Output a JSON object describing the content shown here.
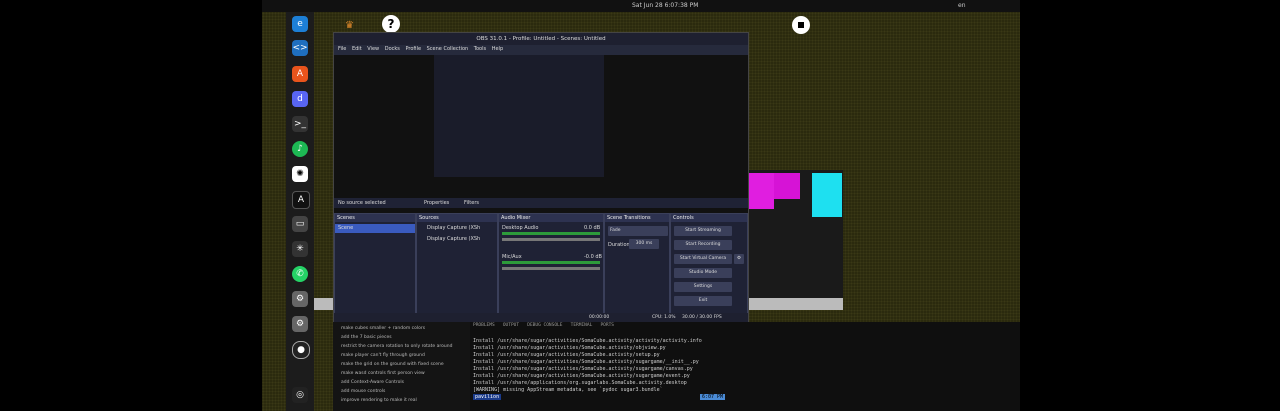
{
  "topbar": {
    "datetime": "Sat Jun 28  6:07:38 PM",
    "lang": "en"
  },
  "obs": {
    "title": "OBS 31.0.1 - Profile: Untitled - Scenes: Untitled",
    "menu": [
      "File",
      "Edit",
      "View",
      "Docks",
      "Profile",
      "Scene Collection",
      "Tools",
      "Help"
    ],
    "no_source": "No source selected",
    "properties": "Properties",
    "filters": "Filters",
    "docks": {
      "scenes": "Scenes",
      "sources": "Sources",
      "audio": "Audio Mixer",
      "transitions": "Scene Transitions",
      "controls": "Controls"
    },
    "scene_item": "Scene",
    "sources": [
      "Display Capture (XSh",
      "Display Capture (XSh"
    ],
    "audio": [
      {
        "name": "Desktop Audio",
        "db": "0.0 dB"
      },
      {
        "name": "Mic/Aux",
        "db": "-0.0 dB"
      }
    ],
    "transition": {
      "value": "Fade",
      "duration_label": "Duration",
      "duration": "300 ms"
    },
    "controls": [
      "Start Streaming",
      "Start Recording",
      "Start Virtual Camera",
      "Studio Mode",
      "Settings",
      "Exit"
    ],
    "status": {
      "time": "00:00:00",
      "cpu": "CPU: 1.0%",
      "fps": "30.00 / 30.00 FPS"
    }
  },
  "terminal": {
    "tabs": [
      "PROBLEMS",
      "OUTPUT",
      "DEBUG CONSOLE",
      "TERMINAL",
      "PORTS"
    ],
    "lines": [
      "Install /usr/share/sugar/activities/SomaCube.activity/activity/activity.info",
      "Install /usr/share/sugar/activities/SomaCube.activity/objview.py",
      "Install /usr/share/sugar/activities/SomaCube.activity/setup.py",
      "Install /usr/share/sugar/activities/SomaCube.activity/sugargame/__init__.py",
      "Install /usr/share/sugar/activities/SomaCube.activity/sugargame/canvas.py",
      "Install /usr/share/sugar/activities/SomaCube.activity/sugargame/event.py",
      "Install /usr/share/applications/org.sugarlabs.SomaCube.activity.desktop",
      "[WARNING] missing AppStream metadata, see `pydoc sugar3.bundle`"
    ],
    "prompt": "6:07 PM",
    "user": "pavilion"
  },
  "chat": {
    "items": [
      "make cubes smaller + random colors",
      "add the 7 basic pieces",
      "restrict the camera rotation to only rotate around",
      "make player can't fly through ground",
      "make the grid on the ground with fixed scene",
      "make wasd controls first person view",
      "add Context-Aware Controls",
      "add mouse controls",
      "improve rendering to make it real"
    ]
  }
}
